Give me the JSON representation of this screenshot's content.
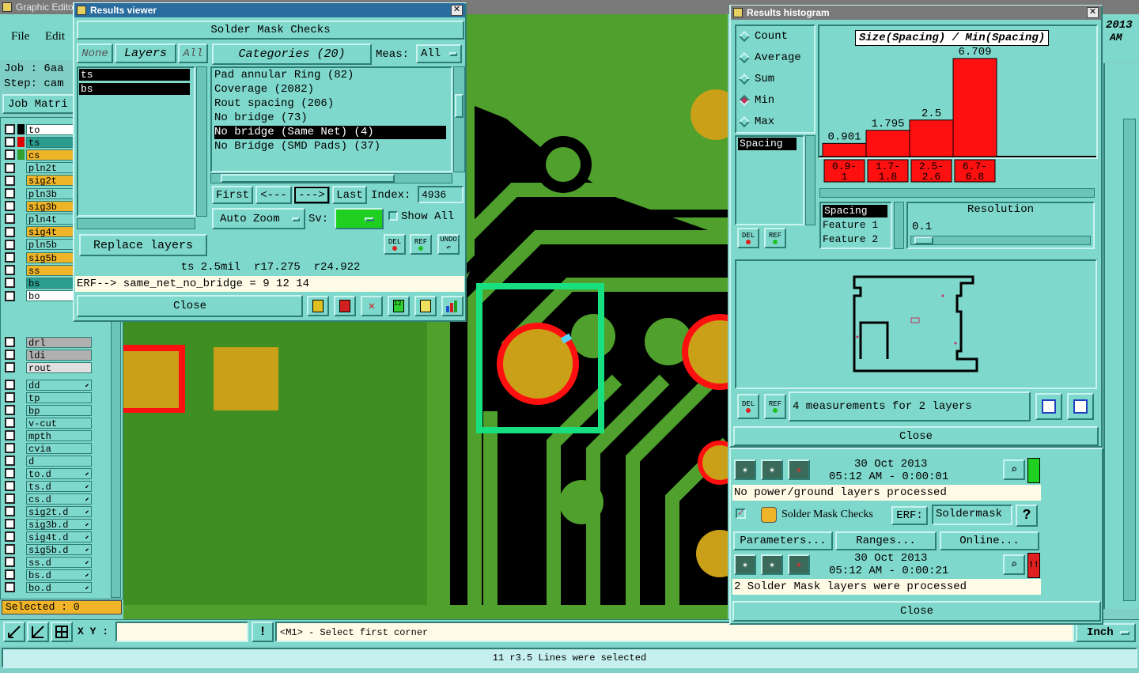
{
  "graphic_editor": {
    "title": "Graphic Edito",
    "menu": [
      "File",
      "Edit"
    ],
    "job_label": "Job : 6aa",
    "step_label": "Step: cam",
    "job_matrix_button": "Job Matri",
    "date_top": "2013",
    "time_top": "AM",
    "selected_text": "Selected : 0",
    "xy_label": "X Y :",
    "xy_value": "",
    "prompt": "<M1> - Select first corner",
    "units": "Inch",
    "status": "11 r3.5 Lines were selected"
  },
  "layers": [
    {
      "name": "to",
      "color": "#ffffff",
      "swatch": "#000000"
    },
    {
      "name": "ts",
      "color": "#2a9d8f",
      "swatch": "#e00000"
    },
    {
      "name": "cs",
      "color": "#f0b429",
      "swatch": "#30a030"
    },
    {
      "name": "pln2t",
      "color": "#7fd8cc",
      "swatch": ""
    },
    {
      "name": "sig2t",
      "color": "#f0b429",
      "swatch": ""
    },
    {
      "name": "pln3b",
      "color": "#7fd8cc",
      "swatch": ""
    },
    {
      "name": "sig3b",
      "color": "#f0b429",
      "swatch": ""
    },
    {
      "name": "pln4t",
      "color": "#7fd8cc",
      "swatch": ""
    },
    {
      "name": "sig4t",
      "color": "#f0b429",
      "swatch": ""
    },
    {
      "name": "pln5b",
      "color": "#7fd8cc",
      "swatch": ""
    },
    {
      "name": "sig5b",
      "color": "#f0b429",
      "swatch": ""
    },
    {
      "name": "ss",
      "color": "#f0b429",
      "swatch": ""
    },
    {
      "name": "bs",
      "color": "#2a9d8f",
      "swatch": ""
    },
    {
      "name": "bo",
      "color": "#ffffff",
      "swatch": ""
    }
  ],
  "drill_layers": [
    "drl",
    "ldi",
    "rout"
  ],
  "doc_layers": [
    "dd",
    "tp",
    "bp",
    "v-cut",
    "mpth",
    "cvia",
    "d",
    "to.d",
    "ts.d",
    "cs.d",
    "sig2t.d",
    "sig3b.d",
    "sig4t.d",
    "sig5b.d",
    "ss.d",
    "bs.d",
    "bo.d"
  ],
  "results_viewer": {
    "title": "Results viewer",
    "header": "Solder Mask Checks",
    "none_btn": "None",
    "layers_btn": "Layers",
    "all_btn": "All",
    "categories_btn": "Categories (20)",
    "meas_label": "Meas:",
    "meas_value": "All",
    "layer_list": [
      "ts",
      "bs"
    ],
    "categories": [
      "Pad annular Ring (82)",
      "Coverage (2082)",
      "Rout spacing (206)",
      "No bridge (73)",
      "No bridge (Same Net) (4)",
      "No Bridge (SMD Pads) (37)"
    ],
    "selected_category": 4,
    "first": "First",
    "prev": "<---",
    "next": "--->",
    "last": "Last",
    "index_label": "Index:",
    "index_value": "4936",
    "auto_zoom": "Auto Zoom",
    "sv_label": "Sv:",
    "show_all": "Show All",
    "replace_layers": "Replace layers",
    "del": "DEL",
    "ref": "REF",
    "undo": "UNDO",
    "info": "ts 2.5mil  r17.275  r24.922",
    "erf": "ERF--> same_net_no_bridge = 9 12 14",
    "close": "Close"
  },
  "histogram": {
    "title": "Results histogram",
    "modes": [
      "Count",
      "Average",
      "Sum",
      "Min",
      "Max"
    ],
    "selected_mode": 3,
    "chart_title": "Size(Spacing) / Min(Spacing)",
    "list_item": "Spacing",
    "del": "DEL",
    "ref": "REF",
    "features": [
      "Spacing",
      "Feature 1",
      "Feature 2"
    ],
    "resolution_label": "Resolution",
    "resolution_value": "0.1",
    "measurements": "4 measurements for 2 layers",
    "close": "Close"
  },
  "chart_data": {
    "type": "bar",
    "title": "Size(Spacing) / Min(Spacing)",
    "categories": [
      "0.9-1",
      "1.7-1.8",
      "2.5-2.6",
      "6.7-6.8"
    ],
    "category_lines": [
      [
        "0.9-",
        "1"
      ],
      [
        "1.7-",
        "1.8"
      ],
      [
        "2.5-",
        "2.6"
      ],
      [
        "6.7-",
        "6.8"
      ]
    ],
    "values": [
      0.901,
      1.795,
      2.5,
      6.709
    ],
    "value_labels": [
      "0.901",
      "1.795",
      "2.5",
      "6.709"
    ],
    "bar_color": "#ff1010",
    "ylim": [
      0,
      6.709
    ]
  },
  "checks": {
    "top_date": "30 Oct 2013",
    "top_time": "05:12 AM - 0:00:01",
    "top_msg": "No power/ground layers processed",
    "action_name": "Solder Mask Checks",
    "erf_label": "ERF:",
    "erf_value": "Soldermask",
    "help": "?",
    "parameters": "Parameters...",
    "ranges": "Ranges...",
    "online": "Online...",
    "bottom_date": "30 Oct 2013",
    "bottom_time": "05:12 AM - 0:00:21",
    "bottom_msg": "2 Solder Mask layers were processed",
    "alert": "!!",
    "close": "Close"
  }
}
